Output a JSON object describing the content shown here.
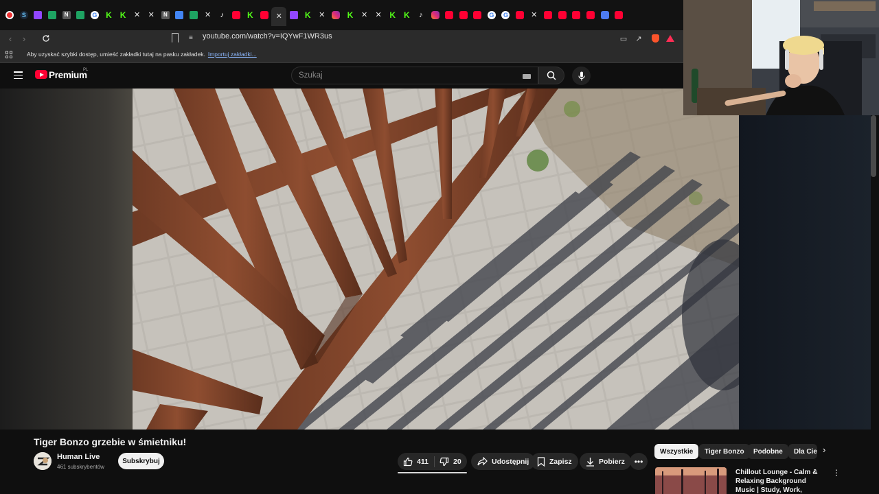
{
  "browser": {
    "url": "youtube.com/watch?v=IQYwF1WR3us",
    "bookmarks_prompt": "Aby uzyskać szybki dostęp, umieść zakładki tutaj na pasku zakładek.",
    "bookmarks_import_link": "Importuj zakładki...",
    "tabs": [
      "rec",
      "steam",
      "twitch",
      "sheet",
      "n",
      "sheet",
      "google",
      "kick",
      "kick",
      "x",
      "x",
      "n",
      "doc",
      "sheet",
      "x",
      "tiktok",
      "yt",
      "kick",
      "yt",
      "close",
      "twitch",
      "kick",
      "x",
      "ig",
      "kick",
      "x",
      "x",
      "kick",
      "kick",
      "tiktok",
      "ig",
      "yt",
      "yt",
      "yt",
      "google",
      "google",
      "yt",
      "x",
      "yt",
      "yt",
      "yt",
      "yt",
      "db",
      "yt"
    ]
  },
  "youtube": {
    "brand": "Premium",
    "region": "PL",
    "search_placeholder": "Szukaj"
  },
  "video": {
    "title": "Tiger Bonzo grzebie w śmietniku!",
    "channel_name": "Human Live",
    "channel_subs": "461 subskrybentów",
    "subscribe_label": "Subskrybuj",
    "likes": "411",
    "dislikes": "20",
    "share_label": "Udostępnij",
    "save_label": "Zapisz",
    "download_label": "Pobierz"
  },
  "chips": [
    "Wszystkie",
    "Tiger Bonzo",
    "Podobne",
    "Dla Ciebie"
  ],
  "recommendation": {
    "title": "Chillout Lounge - Calm & Relaxing Background Music | Study, Work, Sleep"
  },
  "colors": {
    "youtube_red": "#ff0033",
    "background": "#0f0f0f",
    "pill": "#272727"
  }
}
